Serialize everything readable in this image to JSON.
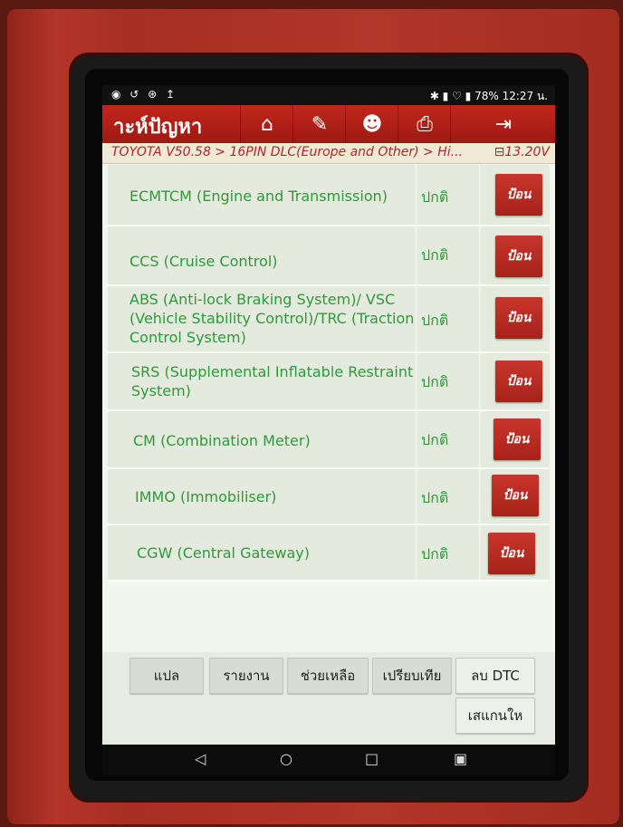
{
  "status_bar": {
    "left_icons": "◉ ↺ ⊛ ↥",
    "right_text": "✱ ▮ ♡ ▮ 78% 12:27 น."
  },
  "title_bar": {
    "title": "าะห์ปัญหา",
    "icons": [
      "home-icon",
      "edit-icon",
      "profile-icon",
      "print-icon",
      "exit-icon"
    ],
    "icon_glyphs": [
      "⌂",
      "✎",
      "☻",
      "⎙",
      "⇥"
    ]
  },
  "breadcrumb": {
    "path": "TOYOTA V50.58 > 16PIN DLC(Europe and Other) > Hi...",
    "voltage": "⊟13.20V"
  },
  "systems": [
    {
      "name": "ECMTCM (Engine and Transmission)",
      "status": "ปกติ",
      "button": "ป้อน"
    },
    {
      "name": "CCS (Cruise Control)",
      "status": "ปกติ",
      "button": "ป้อน"
    },
    {
      "name": "ABS (Anti-lock Braking System)/ VSC (Vehicle Stability Control)/TRC (Traction Control System)",
      "status": "ปกติ",
      "button": "ป้อน"
    },
    {
      "name": "SRS (Supplemental Inflatable Restraint System)",
      "status": "ปกติ",
      "button": "ป้อน"
    },
    {
      "name": "CM (Combination Meter)",
      "status": "ปกติ",
      "button": "ป้อน"
    },
    {
      "name": "IMMO (Immobiliser)",
      "status": "ปกติ",
      "button": "ป้อน"
    },
    {
      "name": "CGW (Central Gateway)",
      "status": "ปกติ",
      "button": "ป้อน"
    }
  ],
  "bottom_buttons": [
    "แปล",
    "รายงาน",
    "ช่วยเหลือ",
    "เปรียบเทีย",
    "ลบ DTC",
    "เสแกนให"
  ],
  "nav_bar": {
    "back": "◁",
    "home": "○",
    "recent": "□",
    "screenshot": "▣"
  },
  "colors": {
    "accent": "#b8281e",
    "text_green": "#2e9a3a"
  }
}
